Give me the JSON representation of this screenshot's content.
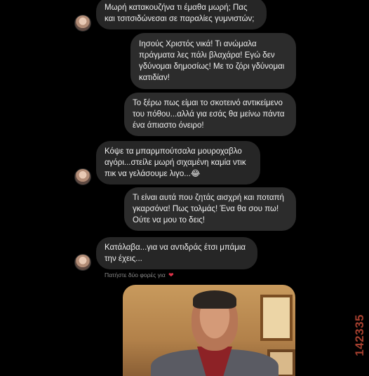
{
  "messages": [
    {
      "sender": "other",
      "lines": [
        "Μωρή κατακουζήνα τι έμαθα μωρή; Πας",
        "και τσιτσιδώνεσαι σε παραλίες γυμνιστών;"
      ]
    },
    {
      "sender": "me",
      "lines": [
        "Ιησούς Χριστός νικά!  Τι ανώμαλα",
        "πράγματα λες πάλι βλαχάρα! Εγώ δεν",
        "γδύνομαι δημοσίως! Με το ζόρι γδύνομαι",
        "κατιδίαν!"
      ]
    },
    {
      "sender": "me",
      "lines": [
        "Το ξέρω πως είμαι το σκοτεινό αντικείμενο",
        "του πόθου...αλλά για εσάς θα μείνω πάντα",
        "ένα άπιαστο όνειρο!"
      ]
    },
    {
      "sender": "other",
      "lines": [
        "Κόψε τα μπαρμπούτσαλα μουροχαβλο",
        "αγόρι...στείλε μωρή σιχαμένη καμία ντικ",
        "πικ να γελάσουμε λιγο...😂"
      ]
    },
    {
      "sender": "me",
      "lines": [
        "Τι είναι αυτά που ζητάς αισχρή και ποταπή",
        "γκαρσόνα! Πως τολμάς! Ένα θα σου πω!",
        "Ούτε να μου το δεις!"
      ]
    },
    {
      "sender": "other",
      "lines": [
        "Κατάλαβα...για να αντιδράς έτσι μπάμια",
        "την έχεις..."
      ]
    }
  ],
  "reaction_hint": {
    "text": "Πατήστε δύο φορές για",
    "icon": "heart-icon"
  },
  "watermark": "142335",
  "colors": {
    "background": "#000000",
    "bubble": "#262626",
    "heart": "#e0334a",
    "watermark": "#a6402f"
  }
}
